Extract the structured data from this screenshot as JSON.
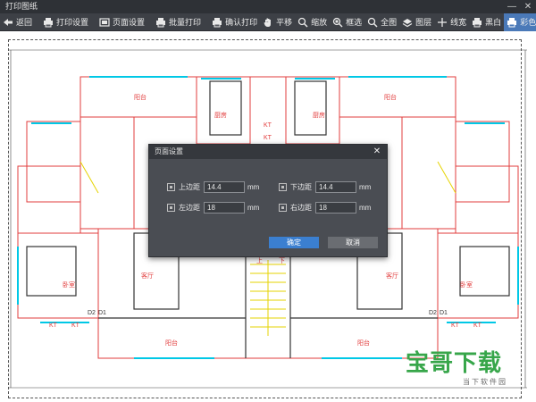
{
  "window": {
    "title": "打印图纸"
  },
  "toolbar": {
    "left": [
      {
        "id": "back",
        "label": "返回",
        "icon": "back-arrow-icon"
      },
      {
        "id": "print-settings",
        "label": "打印设置",
        "icon": "printer-icon"
      },
      {
        "id": "page-settings",
        "label": "页面设置",
        "icon": "page-icon"
      },
      {
        "id": "batch-print",
        "label": "批量打印",
        "icon": "printer-icon"
      },
      {
        "id": "confirm-print",
        "label": "确认打印",
        "icon": "printer-icon"
      }
    ],
    "right": [
      {
        "id": "pan",
        "label": "平移",
        "icon": "hand-icon"
      },
      {
        "id": "zoom",
        "label": "缩放",
        "icon": "zoom-icon"
      },
      {
        "id": "box-select",
        "label": "框选",
        "icon": "zoom-icon"
      },
      {
        "id": "fit-all",
        "label": "全图",
        "icon": "zoom-icon"
      },
      {
        "id": "layers",
        "label": "图层",
        "icon": "layers-icon"
      },
      {
        "id": "line-width",
        "label": "线宽",
        "icon": "plus-icon"
      },
      {
        "id": "black-white",
        "label": "黑白",
        "icon": "printer-icon"
      },
      {
        "id": "color",
        "label": "彩色",
        "icon": "printer-icon",
        "active": true
      }
    ]
  },
  "dialog": {
    "title": "页面设置",
    "top_margin": {
      "label": "上边距",
      "value": "14.4",
      "unit": "mm"
    },
    "bottom_margin": {
      "label": "下边距",
      "value": "14.4",
      "unit": "mm"
    },
    "left_margin": {
      "label": "左边距",
      "value": "18",
      "unit": "mm"
    },
    "right_margin": {
      "label": "右边距",
      "value": "18",
      "unit": "mm"
    },
    "ok_label": "确定",
    "cancel_label": "取消"
  },
  "plan_labels": {
    "balcony": "阳台",
    "kitchen": "厨房",
    "bedroom": "卧室",
    "living": "客厅",
    "kt": "KT",
    "d1": "D1",
    "d2": "D2",
    "up": "上",
    "down": "下"
  },
  "watermark": {
    "text": "宝哥下载",
    "sub": "当下软件园"
  },
  "colors": {
    "titlebar": "#2e3136",
    "toolbar": "#3d4046",
    "accent": "#3b7fd0",
    "wall": "#e23c3c",
    "window": "#00c8e6"
  }
}
